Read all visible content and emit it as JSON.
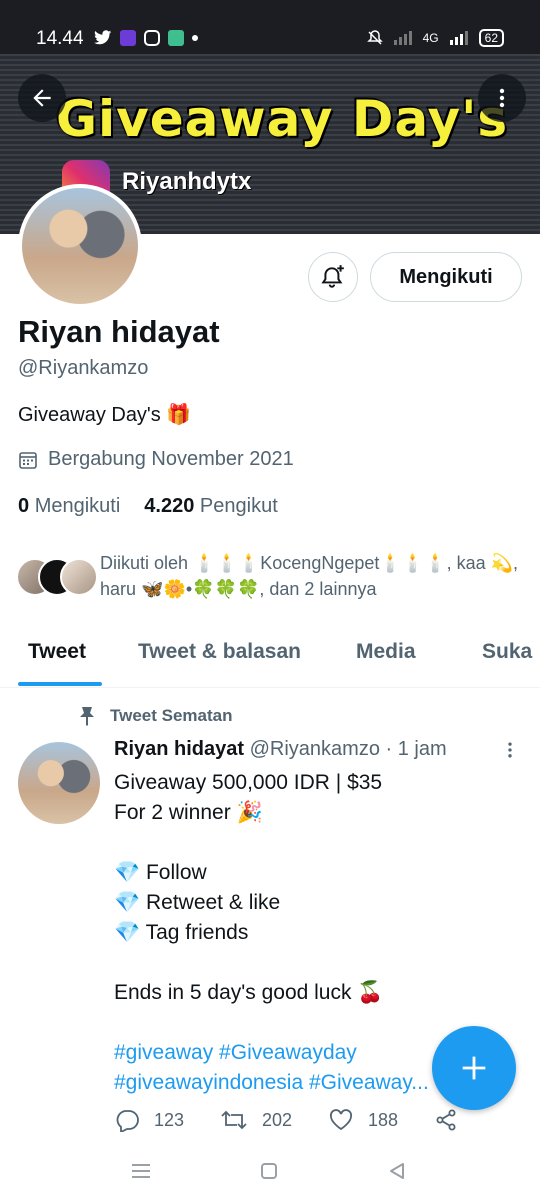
{
  "status_bar": {
    "time": "14.44",
    "network": "4G",
    "battery": "62"
  },
  "banner": {
    "title": "Giveaway Day's",
    "handle": "Riyanhdytx"
  },
  "profile": {
    "name": "Riyan hidayat",
    "handle": "@Riyankamzo",
    "bio": "Giveaway Day's 🎁",
    "joined": "Bergabung November 2021",
    "following_count": "0",
    "following_label": "Mengikuti",
    "followers_count": "4.220",
    "followers_label": "Pengikut",
    "follow_button": "Mengikuti",
    "followed_by": "Diikuti oleh 🕯️🕯️🕯️KocengNgepet🕯️🕯️🕯️, kaa 💫, haru 🦋🌼•🍀🍀🍀, dan 2 lainnya"
  },
  "tabs": [
    "Tweet",
    "Tweet & balasan",
    "Media",
    "Suka"
  ],
  "pinned_label": "Tweet Sematan",
  "tweet": {
    "name": "Riyan hidayat",
    "meta": "@Riyankamzo · 1 jam",
    "lines": [
      "Giveaway 500,000 IDR | $35",
      "For 2 winner 🎉",
      "",
      "💎 Follow",
      "💎 Retweet & like",
      "💎 Tag friends",
      "",
      "Ends in 5 day's good luck 🍒",
      ""
    ],
    "hashtags_1": "#giveaway #Giveawayday",
    "hashtags_2": "#giveawayindonesia #Giveaway...",
    "replies": "123",
    "retweets": "202",
    "likes": "188"
  },
  "colors": {
    "accent": "#1d9bf0",
    "banner_text": "#f6ef3c",
    "muted": "#536471"
  },
  "icons": [
    "arrow-left-icon",
    "more-vertical-icon",
    "bell-plus-icon",
    "calendar-icon",
    "pin-icon",
    "reply-icon",
    "retweet-icon",
    "heart-icon",
    "share-icon",
    "plus-icon"
  ]
}
